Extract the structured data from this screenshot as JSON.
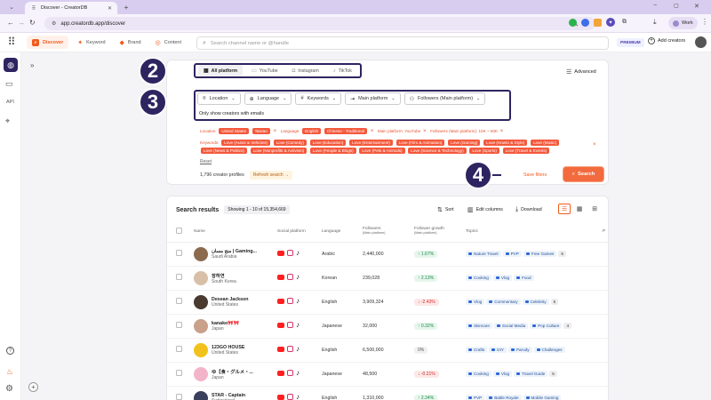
{
  "browser": {
    "tab_title": "Discover - CreatorDB",
    "url": "app.creatordb.app/discover",
    "profile_label": "Work"
  },
  "appnav": {
    "tabs": [
      {
        "label": "Discover",
        "icon": "discover-icon"
      },
      {
        "label": "Keyword",
        "icon": "keyword-icon"
      },
      {
        "label": "Brand",
        "icon": "brand-icon"
      },
      {
        "label": "Content",
        "icon": "content-icon"
      }
    ],
    "search_placeholder": "Search channel name or @handle",
    "premium_label": "PREMIUM",
    "add_creators_label": "Add creators"
  },
  "sidebar": {
    "api_label": "API"
  },
  "filters": {
    "platform_tabs": [
      "All platform",
      "YouTube",
      "Instagram",
      "TikTok"
    ],
    "advanced_label": "Advanced",
    "dropdowns": [
      "Location",
      "Language",
      "Keywords",
      "Main platform",
      "Followers (Main platform)"
    ],
    "emails_label": "Only show creators with emails",
    "location_label": "Location:",
    "location_chips": [
      "United States",
      "Taiwan"
    ],
    "language_label": "Language:",
    "language_chips": [
      "English",
      "Chinese - Traditional"
    ],
    "main_platform": "Main platform: YouTube",
    "followers": "Followers (Main platform): 10K ~ 50K",
    "keywords_label": "Keywords:",
    "keyword_chips_row1": [
      "Love (Autos & Vehicles)",
      "Love (Comedy)",
      "Love (Education)",
      "Love (Entertainment)",
      "Love (Film & Animation)",
      "Love (Gaming)",
      "Love (Howto & Style)",
      "Love (Music)"
    ],
    "keyword_chips_row2": [
      "Love (News & Politics)",
      "Love (Nonprofits & Activism)",
      "Love (People & Blogs)",
      "Love (Pets & Animals)",
      "Love (Science & Technology)",
      "Love (Sports)",
      "Love (Travel & Events)"
    ],
    "reset_label": "Reset",
    "profile_count": "1,796 creator profiles",
    "refresh_label": "Refresh search →",
    "save_filters_label": "Save filters",
    "search_button_label": "Search"
  },
  "annotations": {
    "step2": "2",
    "step3": "3",
    "step4": "4"
  },
  "results": {
    "title": "Search results",
    "range": "Showing 1 - 10 of 15,354,669",
    "sort_label": "Sort",
    "edit_columns_label": "Edit columns",
    "download_label": "Download",
    "columns": {
      "name": "Name",
      "social": "Social platform",
      "language": "Language",
      "followers": "Followers",
      "followers_sub": "(Main platform)",
      "growth": "Follower growth",
      "growth_sub": "(Main platform)",
      "topics": "Topics",
      "extra": "P"
    },
    "rows": [
      {
        "name": "منج مسان | Gaming...",
        "country": "Saudi Arabia",
        "language": "Arabic",
        "followers": "2,440,000",
        "growth": "↑ 1.67%",
        "trend": "up",
        "topics": [
          "Nature Travel",
          "PVP",
          "Free Games"
        ],
        "more": "5",
        "avatar": "#8b6a4e"
      },
      {
        "name": "장하연",
        "country": "South Korea",
        "language": "Korean",
        "followers": "239,028",
        "growth": "↑ 2.13%",
        "trend": "up",
        "topics": [
          "Cooking",
          "Vlog",
          "Food"
        ],
        "more": "",
        "avatar": "#d8c0a8"
      },
      {
        "name": "Desean Jackson",
        "country": "United States",
        "language": "English",
        "followers": "3,909,324",
        "growth": "↓ -2.43%",
        "trend": "down",
        "topics": [
          "Vlog",
          "Commentary",
          "Celebrity"
        ],
        "more": "5",
        "avatar": "#4a3a30"
      },
      {
        "name": "kanako🎀🎀",
        "country": "Japan",
        "language": "Japanese",
        "followers": "32,000",
        "growth": "↑ 0.32%",
        "trend": "up",
        "topics": [
          "Skincare",
          "Social Media",
          "Pop Culture"
        ],
        "more": "4",
        "avatar": "#c9a08a"
      },
      {
        "name": "123GO HOUSE",
        "country": "United States",
        "language": "English",
        "followers": "6,500,000",
        "growth": "0%",
        "trend": "neutral",
        "topics": [
          "Crafts",
          "DIY",
          "Parody",
          "Challenges"
        ],
        "more": "",
        "avatar": "#f1c21b"
      },
      {
        "name": "ゆ【食・グルメ・...",
        "country": "Japan",
        "language": "Japanese",
        "followers": "48,500",
        "growth": "↓ -0.21%",
        "trend": "down",
        "topics": [
          "Cooking",
          "Vlog",
          "Travel Guide"
        ],
        "more": "5",
        "avatar": "#f3b3c9"
      },
      {
        "name": "STAR - Captain",
        "country": "Switzerland",
        "language": "English",
        "followers": "1,310,000",
        "growth": "↑ 2.34%",
        "trend": "up",
        "topics": [
          "PVP",
          "Battle Royale",
          "Mobile Gaming"
        ],
        "more": "",
        "avatar": "#3a3f5c"
      }
    ]
  },
  "colors": {
    "accent": "#f05a1c",
    "annotation": "#2e2460"
  }
}
